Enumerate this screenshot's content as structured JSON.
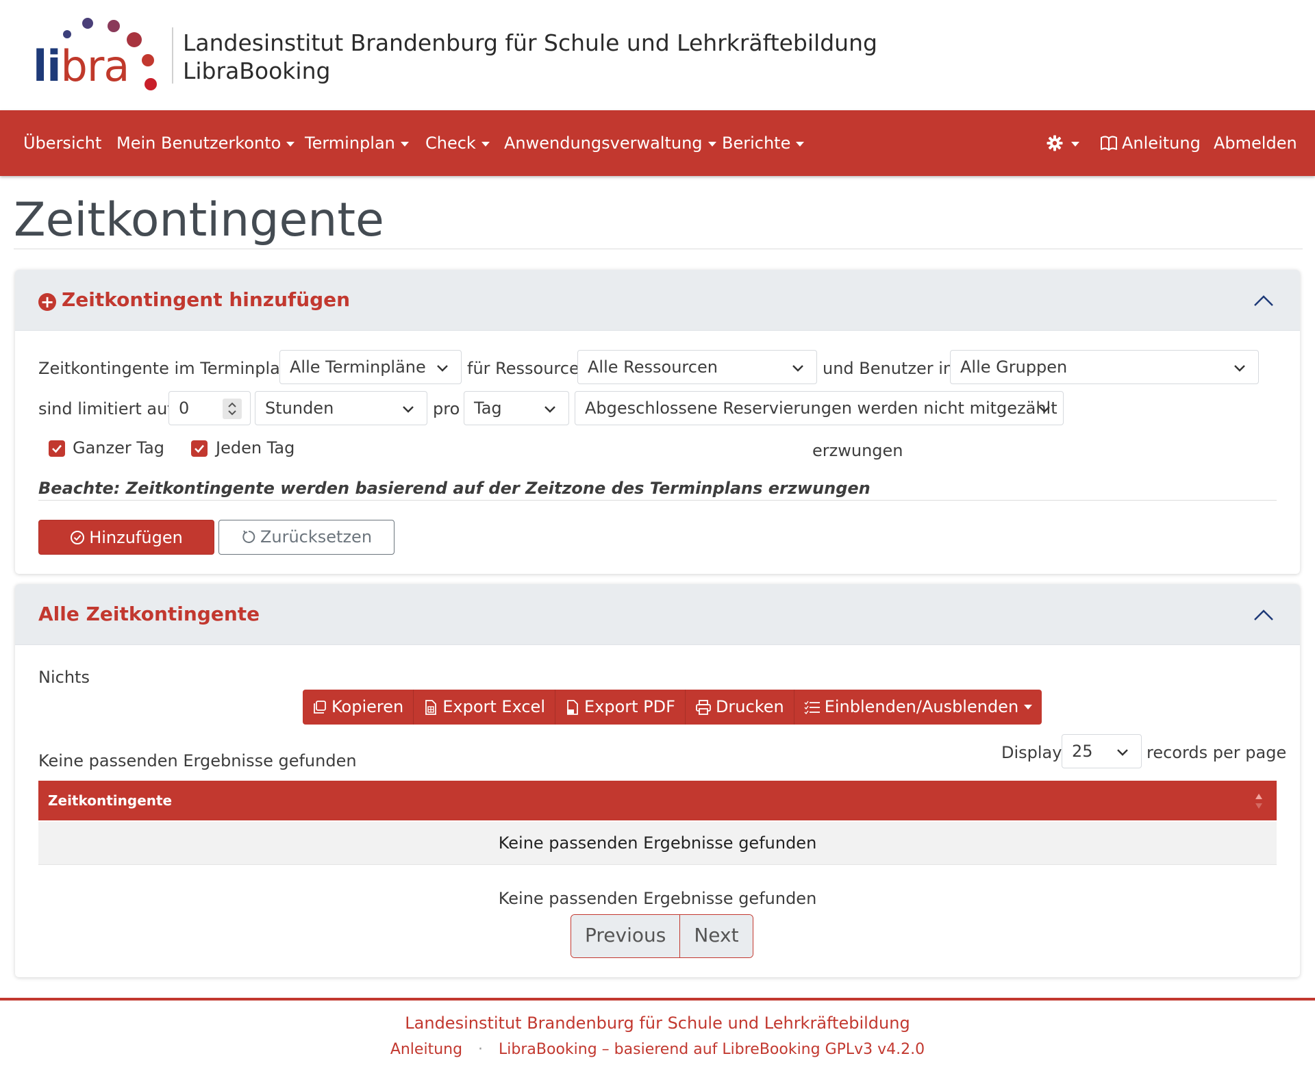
{
  "header": {
    "logo_li": "li",
    "logo_bra": "bra",
    "institute": "Landesinstitut Brandenburg für Schule und Lehrkräftebildung",
    "app_name": "LibraBooking"
  },
  "nav": {
    "overview": "Übersicht",
    "account": "Mein Benutzerkonto",
    "schedule": "Terminplan",
    "check": "Check",
    "admin": "Anwendungsverwaltung",
    "reports": "Berichte",
    "manual": "Anleitung",
    "logout": "Abmelden"
  },
  "page": {
    "title": "Zeitkontingente"
  },
  "add_card": {
    "title": "Zeitkontingent hinzufügen",
    "label_schedule": "Zeitkontingente im Terminplan",
    "schedule_value": "Alle Terminpläne",
    "label_resource": "für Ressource",
    "resource_value": "Alle Ressourcen",
    "label_group": "und Benutzer in",
    "group_value": "Alle Gruppen",
    "label_limit": "sind limitiert auf",
    "limit_value": "0",
    "unit_value": "Stunden",
    "label_per": "pro",
    "period_value": "Tag",
    "completed_value": "Abgeschlossene Reservierungen werden nicht mitgezählt",
    "whole_day": "Ganzer Tag",
    "every_day": "Jeden Tag",
    "enforced": "erzwungen",
    "note": "Beachte: Zeitkontingente werden basierend auf der Zeitzone des Terminplans erzwungen",
    "add_button": "Hinzufügen",
    "reset_button": "Zurücksetzen"
  },
  "list_card": {
    "title": "Alle Zeitkontingente",
    "nothing": "Nichts",
    "buttons": {
      "copy": "Kopieren",
      "excel": "Export Excel",
      "pdf": "Export PDF",
      "print": "Drucken",
      "columns": "Einblenden/Ausblenden"
    },
    "no_results_top": "Keine passenden Ergebnisse gefunden",
    "display_label": "Display",
    "page_size": "25",
    "records_label": "records per page",
    "column_header": "Zeitkontingente",
    "empty_row": "Keine passenden Ergebnisse gefunden",
    "info": "Keine passenden Ergebnisse gefunden",
    "prev": "Previous",
    "next": "Next"
  },
  "footer": {
    "institute": "Landesinstitut Brandenburg für Schule und Lehrkräftebildung",
    "manual": "Anleitung",
    "separator": "·",
    "credits": "LibraBooking – basierend auf LibreBooking GPLv3 v4.2.0"
  },
  "colors": {
    "brand_red": "#c2382f",
    "navy": "#1e3a78",
    "panel_gray": "#e9ecef"
  }
}
